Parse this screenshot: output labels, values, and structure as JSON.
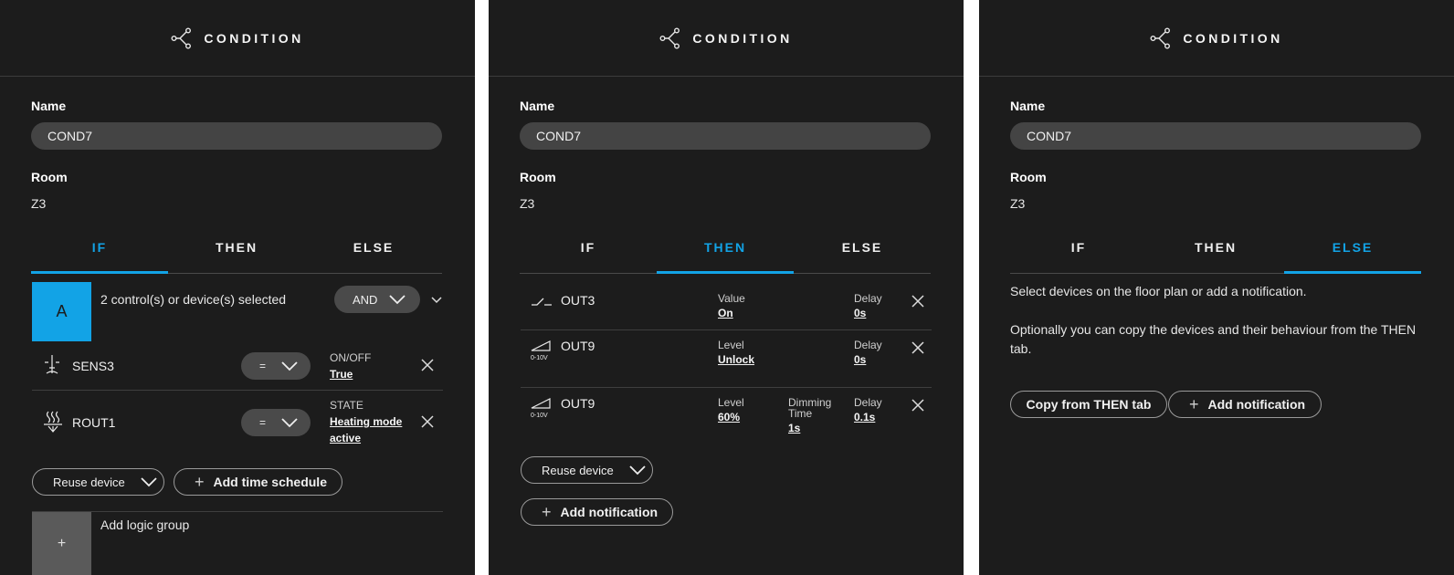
{
  "header": {
    "title": "CONDITION"
  },
  "common": {
    "name_label": "Name",
    "name_value": "COND7",
    "room_label": "Room",
    "room_value": "Z3",
    "tabs": [
      "IF",
      "THEN",
      "ELSE"
    ]
  },
  "if_panel": {
    "group_letter": "A",
    "group_summary": "2 control(s) or device(s) selected",
    "logic_operator": "AND",
    "devices": [
      {
        "name": "SENS3",
        "operator": "=",
        "param_label": "ON/OFF",
        "param_value": "True",
        "icon": "sensor-icon"
      },
      {
        "name": "ROUT1",
        "operator": "=",
        "param_label": "STATE",
        "param_value_line1": "Heating mode",
        "param_value_line2": "active",
        "icon": "heating-cooling-icon"
      }
    ],
    "reuse_label": "Reuse device",
    "add_schedule_label": "Add time schedule",
    "add_logic_plus": "+",
    "add_logic_label": "Add logic group"
  },
  "then_panel": {
    "rows": [
      {
        "name": "OUT3",
        "icon": "switch-icon",
        "p1_label": "Value",
        "p1_value": "On",
        "delay_label": "Delay",
        "delay_value": "0s"
      },
      {
        "name": "OUT9",
        "icon": "dimmer-0-10v-icon",
        "icon_text": "0-10V",
        "p1_label": "Level",
        "p1_value": "Unlock",
        "delay_label": "Delay",
        "delay_value": "0s"
      },
      {
        "name": "OUT9",
        "icon": "dimmer-0-10v-icon",
        "icon_text": "0-10V",
        "p1_label": "Level",
        "p1_value": "60%",
        "p2_label_line1": "Dimming",
        "p2_label_line2": "Time",
        "p2_value": "1s",
        "delay_label": "Delay",
        "delay_value": "0.1s"
      }
    ],
    "reuse_label": "Reuse device",
    "add_notification_label": "Add notification"
  },
  "else_panel": {
    "info_line1": "Select devices on the floor plan or add a notification.",
    "info_line2": "Optionally you can copy the devices and their behaviour from the THEN",
    "info_line3": "tab.",
    "copy_label": "Copy from THEN tab",
    "add_notification_label": "Add notification"
  },
  "colors": {
    "panel_bg": "#1c1c1c",
    "accent": "#12a3e6",
    "input_bg": "#444444",
    "logic_tile_gray": "#5a5a5a"
  }
}
